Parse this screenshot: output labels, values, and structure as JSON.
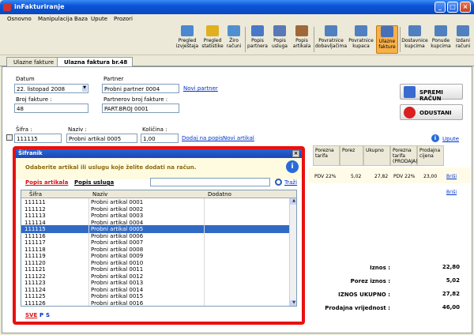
{
  "window": {
    "title": "inFakturiranje",
    "min": "_",
    "max": "□",
    "close": "×"
  },
  "menu": [
    "Osnovno",
    "Manipulacija",
    "Baza",
    "Upute",
    "Prozori"
  ],
  "toolbar": [
    {
      "label": "Pregled izvještaja",
      "color": "#4a88d0"
    },
    {
      "label": "Pregled statistike",
      "color": "#e0b020"
    },
    {
      "label": "Žiro računi",
      "color": "#5090d0"
    },
    {
      "label": "Popis partnera",
      "color": "#4a78c8"
    },
    {
      "label": "Popis usluga",
      "color": "#5878b8"
    },
    {
      "label": "Popis artikala",
      "color": "#a06838"
    },
    {
      "label": "Povratnice dobavljačima",
      "color": "#5080c0"
    },
    {
      "label": "Povratnice kupaca",
      "color": "#5080c0"
    },
    {
      "label": "Ulazne fakture",
      "color": "#4870b8"
    },
    {
      "label": "Dostavnice kupcima",
      "color": "#5080c0"
    },
    {
      "label": "Ponude kupcima",
      "color": "#5080c0"
    },
    {
      "label": "Izdani računi",
      "color": "#5080c0"
    }
  ],
  "tabs": [
    "Ulazne fakture",
    "Ulazna faktura br.48"
  ],
  "form": {
    "datum_label": "Datum",
    "datum_value": "22. listopad  2008",
    "partner_label": "Partner",
    "partner_value": "Probni partner 0004",
    "novi_partner": "Novi partner",
    "broj_label": "Broj fakture :",
    "broj_value": "48",
    "pbroj_label": "Partnerov broj fakture :",
    "pbroj_value": "PART.BROJ 0001",
    "sifra_label": "Šifra :",
    "sifra_value": "111115",
    "naziv_label": "Naziv :",
    "naziv_value": "Probni artikal 0005",
    "kolicina_label": "Količina :",
    "kolicina_value": "1,00",
    "dodaj_link": "Dodaj na popis",
    "novi_artikal": "Novi artikal",
    "upute": "Upute"
  },
  "actions": {
    "spremi": "SPREMI RAČUN",
    "odustani": "ODUSTANI"
  },
  "table": {
    "headers": [
      "Porezna tarifa",
      "Porez",
      "Ukupno",
      "Porezna tarifa (PRODAJA)",
      "Prodajna cijena"
    ],
    "row": [
      "PDV 22%",
      "5,02",
      "27,82",
      "PDV 22%",
      "23,00"
    ],
    "brisi": "Briši"
  },
  "totals": [
    {
      "label": "Iznos :",
      "value": "22,80"
    },
    {
      "label": "Porez iznos :",
      "value": "5,02"
    },
    {
      "label": "IZNOS UKUPNO :",
      "value": "27,82"
    },
    {
      "label": "Prodajna vrijednost :",
      "value": "46,00"
    }
  ],
  "dialog": {
    "title": "Šifranik",
    "close": "×",
    "prompt": "Odaberite artikal ili uslugu koje želite dodati na račun.",
    "tab_artikala": "Popis artikala",
    "tab_usluga": "Popis usluga",
    "trazi": "Traži",
    "columns": [
      "Šifra",
      "Naziv",
      "Dodatno"
    ],
    "rows": [
      [
        "111111",
        "Probni artikal 0001"
      ],
      [
        "111112",
        "Probni artikal 0002"
      ],
      [
        "111113",
        "Probni artikal 0003"
      ],
      [
        "111114",
        "Probni artikal 0004"
      ],
      [
        "111115",
        "Probni artikal 0005"
      ],
      [
        "111116",
        "Probni artikal 0006"
      ],
      [
        "111117",
        "Probni artikal 0007"
      ],
      [
        "111118",
        "Probni artikal 0008"
      ],
      [
        "111119",
        "Probni artikal 0009"
      ],
      [
        "111120",
        "Probni artikal 0010"
      ],
      [
        "111121",
        "Probni artikal 0011"
      ],
      [
        "111122",
        "Probni artikal 0012"
      ],
      [
        "111123",
        "Probni artikal 0013"
      ],
      [
        "111124",
        "Probni artikal 0014"
      ],
      [
        "111125",
        "Probni artikal 0015"
      ],
      [
        "111126",
        "Probni artikal 0016"
      ]
    ],
    "selected_index": 4,
    "filter_sve": "SVE",
    "filter_p": "P",
    "filter_s": "S"
  }
}
